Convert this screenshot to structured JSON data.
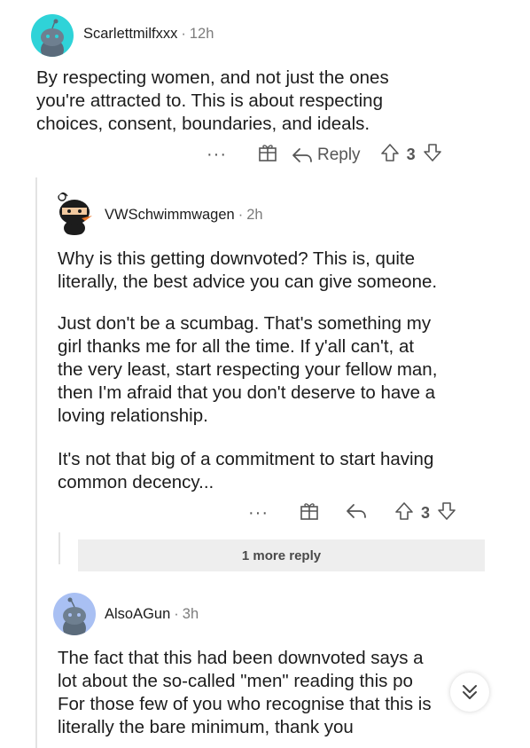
{
  "comments": [
    {
      "username": "Scarlettmilfxxx",
      "age": "12h",
      "avatar_icon": "snoo-avatar-teal",
      "paragraphs": [
        "By respecting women, and not just the ones\nyou're attracted to. This is about respecting\nchoices, consent, boundaries, and ideals."
      ],
      "reply_label": "Reply",
      "score": "3"
    },
    {
      "username": "VWSchwimmwagen",
      "age": "2h",
      "avatar_icon": "snoo-avatar-ninja",
      "paragraphs": [
        "Why is this getting downvoted? This is, quite\nliterally, the best advice you can give someone.",
        "Just don't be a scumbag. That's something my\ngirl thanks me for all the time. If y'all can't, at\nthe very least, start respecting your fellow man,\nthen I'm afraid that you don't deserve to have a\nloving relationship.",
        "It's not that big of a commitment to start having\ncommon decency..."
      ],
      "score": "3",
      "more_replies": "1 more reply"
    },
    {
      "username": "AlsoAGun",
      "age": "3h",
      "avatar_icon": "snoo-avatar-blue",
      "paragraphs": [
        "The fact that this had been downvoted says a\nlot about the so-called \"men\" reading this po\nFor those few of you who recognise that this is\nliterally the bare minimum, thank you"
      ]
    }
  ],
  "colors": {
    "teal_avatar": "#2fd3d8",
    "blue_avatar": "#a9c0f3",
    "thread_line": "#e3e3e3",
    "muted": "#7c7c7c"
  }
}
